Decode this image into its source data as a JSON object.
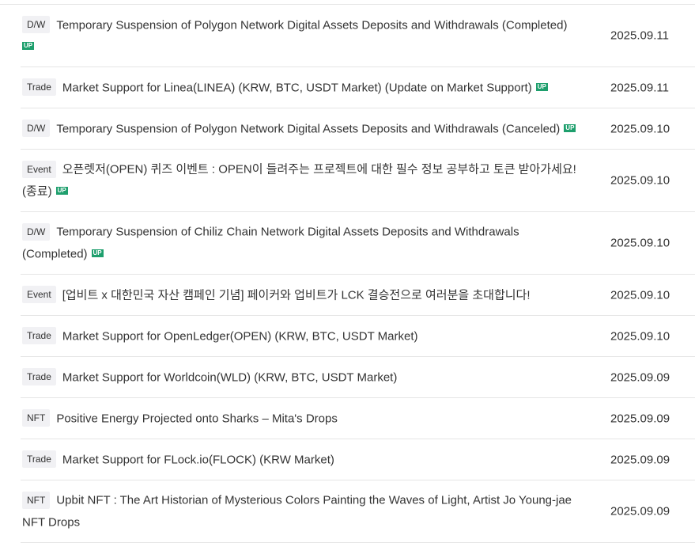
{
  "notices": [
    {
      "category": "D/W",
      "title": "Temporary Suspension of Polygon Network Digital Assets Deposits and Withdrawals (Completed)",
      "up": "UP",
      "date": "2025.09.11"
    },
    {
      "category": "Trade",
      "title": "Market Support for Linea(LINEA) (KRW, BTC, USDT Market) (Update on Market Support)",
      "up": "UP",
      "date": "2025.09.11"
    },
    {
      "category": "D/W",
      "title": "Temporary Suspension of Polygon Network Digital Assets Deposits and Withdrawals (Canceled)",
      "up": "UP",
      "date": "2025.09.10"
    },
    {
      "category": "Event",
      "title": "오픈렛저(OPEN) 퀴즈 이벤트 : OPEN이 들려주는 프로젝트에 대한 필수 정보 공부하고 토큰 받아가세요! (종료)",
      "up": "UP",
      "date": "2025.09.10"
    },
    {
      "category": "D/W",
      "title": "Temporary Suspension of Chiliz Chain Network Digital Assets Deposits and Withdrawals (Completed)",
      "up": "UP",
      "date": "2025.09.10"
    },
    {
      "category": "Event",
      "title": "[업비트 x 대한민국 자산 캠페인 기념] 페이커와 업비트가 LCK 결승전으로 여러분을 초대합니다!",
      "up": "",
      "date": "2025.09.10"
    },
    {
      "category": "Trade",
      "title": "Market Support for OpenLedger(OPEN) (KRW, BTC, USDT Market)",
      "up": "",
      "date": "2025.09.10"
    },
    {
      "category": "Trade",
      "title": "Market Support for Worldcoin(WLD) (KRW, BTC, USDT Market)",
      "up": "",
      "date": "2025.09.09"
    },
    {
      "category": "NFT",
      "title": "Positive Energy Projected onto Sharks – Mita's Drops",
      "up": "",
      "date": "2025.09.09"
    },
    {
      "category": "Trade",
      "title": "Market Support for FLock.io(FLOCK) (KRW Market)",
      "up": "",
      "date": "2025.09.09"
    },
    {
      "category": "NFT",
      "title": "Upbit NFT : The Art Historian of Mysterious Colors Painting the Waves of Light, Artist Jo Young-jae NFT Drops",
      "up": "",
      "date": "2025.09.09"
    }
  ]
}
